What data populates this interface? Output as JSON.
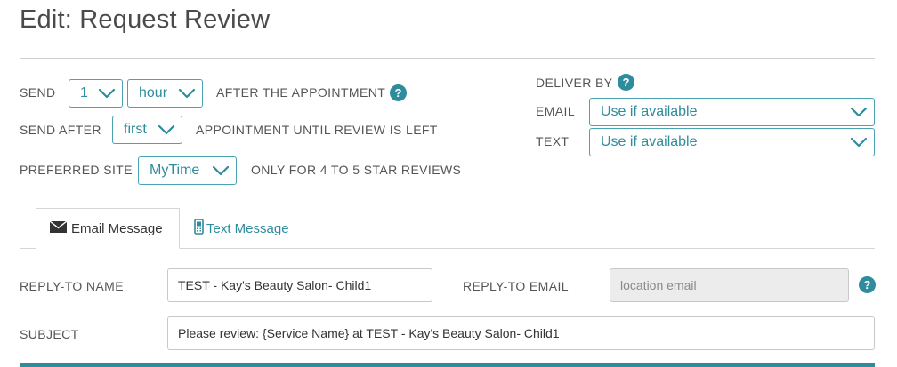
{
  "page": {
    "title": "Edit: Request Review"
  },
  "schedule": {
    "send_label": "SEND",
    "send_count": "1",
    "send_unit": "hour",
    "after_label": "AFTER THE APPOINTMENT",
    "send_after_label": "SEND AFTER",
    "send_after_value": "first",
    "until_label": "APPOINTMENT UNTIL REVIEW IS LEFT",
    "preferred_site_label": "PREFERRED SITE",
    "preferred_site_value": "MyTime",
    "star_label": "ONLY FOR 4 TO 5 STAR REVIEWS"
  },
  "deliver": {
    "heading": "DELIVER BY",
    "email_label": "EMAIL",
    "email_value": "Use if available",
    "text_label": "TEXT",
    "text_value": "Use if available"
  },
  "tabs": [
    {
      "label": "Email Message",
      "icon": "envelope-icon",
      "active": true
    },
    {
      "label": "Text Message",
      "icon": "phone-icon",
      "active": false
    }
  ],
  "form": {
    "reply_to_name_label": "REPLY-TO NAME",
    "reply_to_name_value": "TEST - Kay's Beauty Salon- Child1",
    "reply_to_email_label": "REPLY-TO EMAIL",
    "reply_to_email_placeholder": "location email",
    "subject_label": "SUBJECT",
    "subject_value": "Please review: {Service Name} at TEST - Kay's Beauty Salon- Child1"
  },
  "help_glyph": "?",
  "colors": {
    "accent": "#2e8c9c",
    "dropdown_border": "#4aa3b3",
    "disabled_bg": "#ececec"
  }
}
